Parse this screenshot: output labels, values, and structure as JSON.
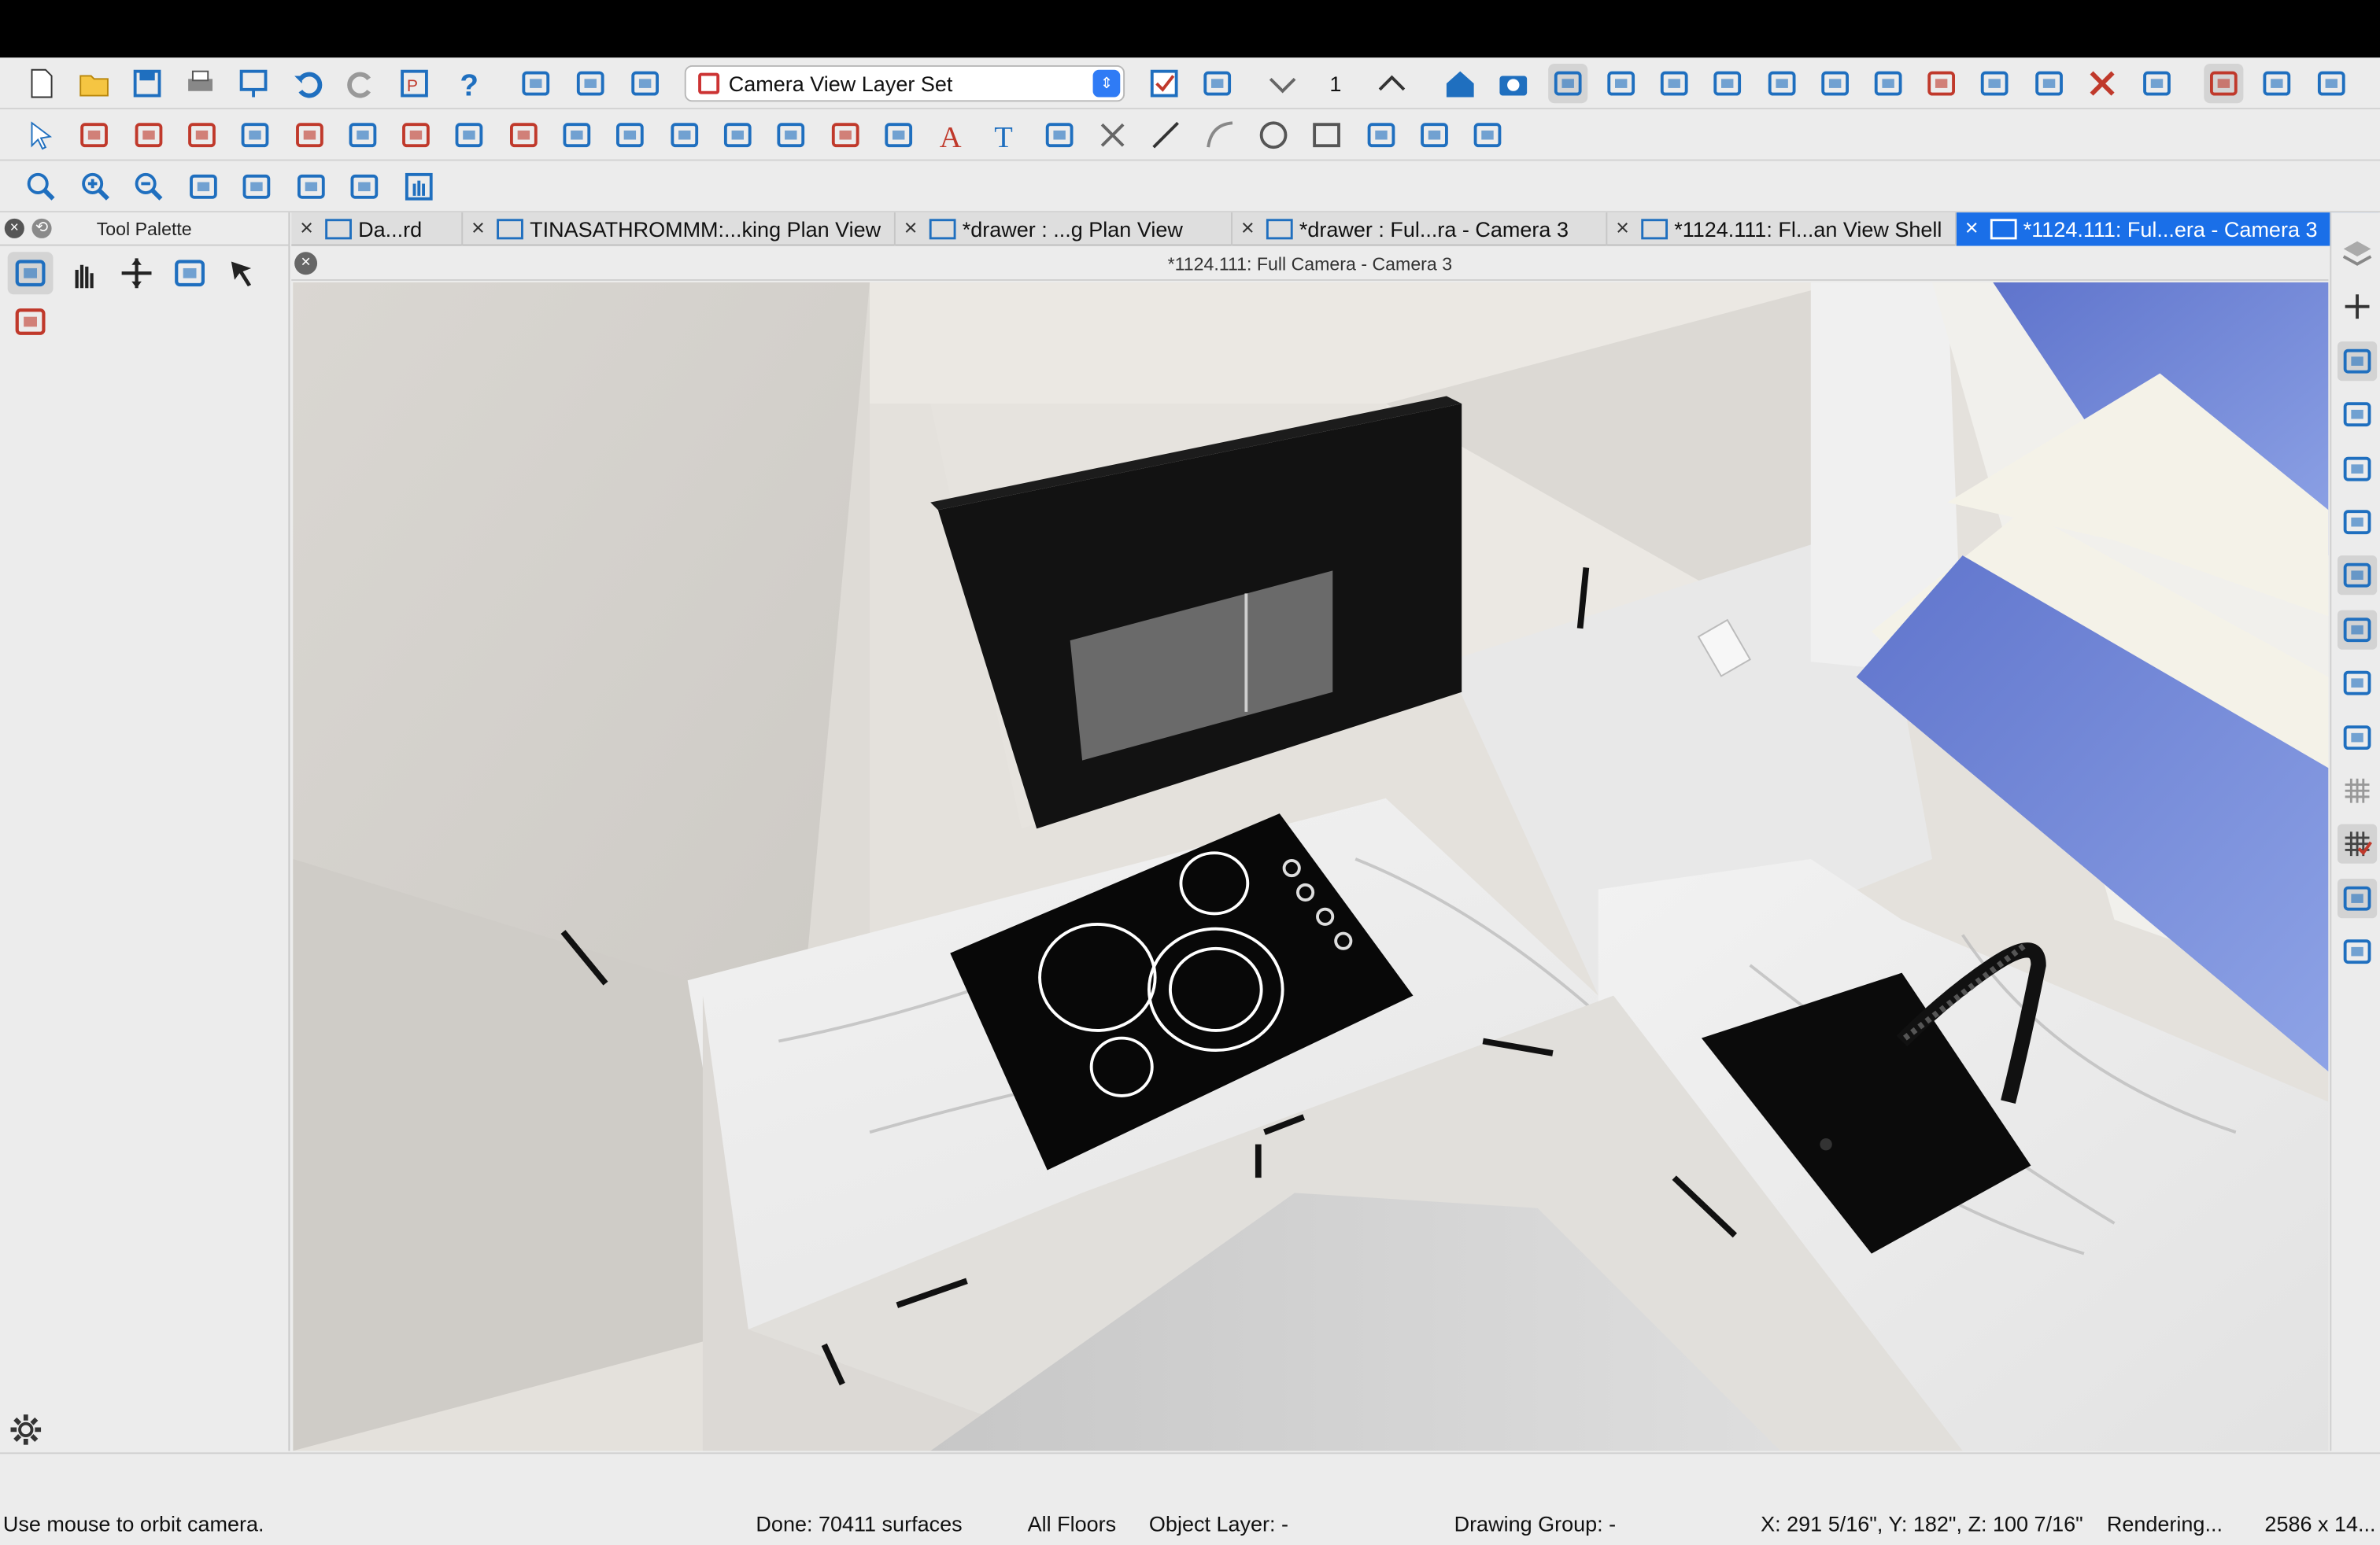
{
  "toolbar1": {
    "layer_set": "Camera View Layer Set",
    "number": "1"
  },
  "palette": {
    "title": "Tool Palette"
  },
  "tabs": [
    {
      "label": "Da...rd"
    },
    {
      "label": "TINASATHROMMM:...king Plan View"
    },
    {
      "label": "*drawer : ...g Plan View"
    },
    {
      "label": "*drawer : Ful...ra - Camera 3"
    },
    {
      "label": "*1124.111: Fl...an View Shell"
    },
    {
      "label": "*1124.111: Ful...era - Camera 3"
    }
  ],
  "view": {
    "title": "*1124.111: Full Camera - Camera 3"
  },
  "status": {
    "hint": "Use mouse to orbit camera.",
    "done": "Done:  70411 surfaces",
    "floors": "All Floors",
    "object_layer": "Object Layer: -",
    "drawing_group": "Drawing Group: -",
    "coords": "X: 291 5/16\", Y: 182\", Z: 100 7/16\"",
    "rendering": "Rendering...",
    "size": "2586 x 14..."
  },
  "colors": {
    "accent": "#1a6fe8",
    "toolbar_bg": "#ececec",
    "icon_blue": "#1f6fbf",
    "icon_red": "#c0392b"
  },
  "icons": {
    "toolbar1": [
      "new-file-icon",
      "open-folder-icon",
      "save-icon",
      "print-icon",
      "print-preview-icon",
      "undo-icon",
      "redo-icon",
      "layout-icon",
      "help-icon",
      "edit-icon",
      "send-layout-icon",
      "update-layout-icon",
      "layer-set-dropdown",
      "check-icon",
      "wrench-icon",
      "down-floor-icon",
      "up-floor-icon",
      "home-icon",
      "camera-icon",
      "camera-mouse-icon",
      "cross-section-icon",
      "walkthrough-icon",
      "orbit-icon",
      "house-icon",
      "light-icon",
      "sun-icon",
      "door-icon",
      "pen-icon",
      "eyedropper-icon",
      "x-icon",
      "ruler-icon",
      "render-icon",
      "material-icon",
      "split-view-icon"
    ],
    "toolbar2": [
      "select-icon",
      "stairs-icon",
      "wall-icon",
      "cabinet-icon",
      "window-icon",
      "door-icon",
      "room-icon",
      "fixture-icon",
      "floor-icon",
      "roof-icon",
      "house-build-icon",
      "framing-icon",
      "slab-icon",
      "terrain-icon",
      "shelf-icon",
      "box-icon",
      "dimension-icon",
      "text-red-icon",
      "text-icon",
      "cloud-icon",
      "cross-icon",
      "line-icon",
      "arc-icon",
      "circle-icon",
      "rectangle-icon",
      "spline-icon",
      "image-icon",
      "cad-icon"
    ],
    "toolbar3": [
      "zoom-icon",
      "zoom-in-icon",
      "zoom-out-icon",
      "fill-icon",
      "fit-icon",
      "fill-window-icon",
      "full-icon",
      "pan-icon"
    ],
    "palette": [
      "select-objects-icon",
      "pan-hand-icon",
      "move-icon",
      "edit-handle-icon",
      "arrow-icon",
      "select-extra-icon"
    ],
    "right": [
      "layers-icon",
      "plus-icon",
      "object-props-icon",
      "line-tool-icon",
      "page-icon",
      "zoom-page-icon",
      "snap-icon",
      "edit-check-icon",
      "arc-snap-icon",
      "picture-icon",
      "grid-icon",
      "grid-check-icon",
      "bound-icon",
      "slope-icon"
    ]
  }
}
